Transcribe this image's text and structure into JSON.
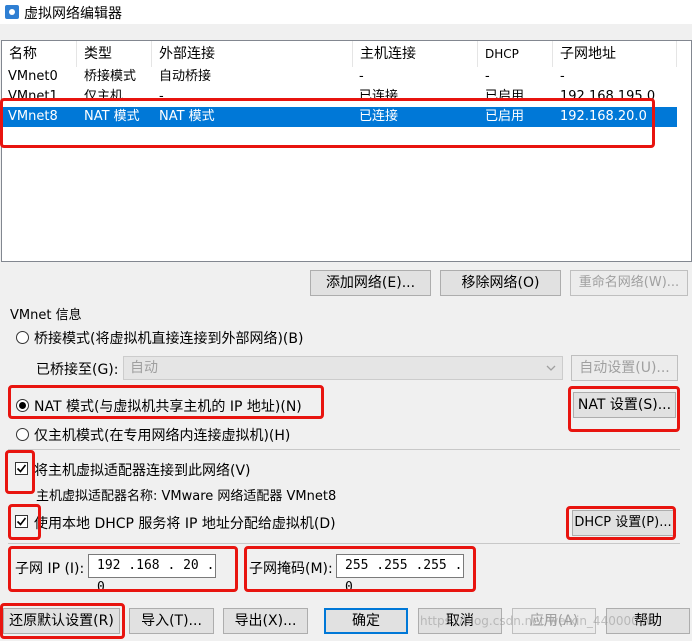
{
  "window": {
    "title": "虚拟网络编辑器"
  },
  "table": {
    "columns": [
      "名称",
      "类型",
      "外部连接",
      "主机连接",
      "DHCP",
      "子网地址"
    ],
    "rows": [
      [
        "VMnet0",
        "桥接模式",
        "自动桥接",
        "-",
        "-",
        "-"
      ],
      [
        "VMnet1",
        "仅主机...",
        "-",
        "已连接",
        "已启用",
        "192.168.195.0"
      ],
      [
        "VMnet8",
        "NAT 模式",
        "NAT 模式",
        "已连接",
        "已启用",
        "192.168.20.0"
      ]
    ]
  },
  "list_buttons": {
    "add": "添加网络(E)...",
    "remove": "移除网络(O)",
    "rename": "重命名网络(W)..."
  },
  "vmnet_info": {
    "group_label": "VMnet 信息",
    "bridge_radio": "桥接模式(将虚拟机直接连接到外部网络)(B)",
    "bridged_to_label": "已桥接至(G):",
    "bridged_to_value": "自动",
    "auto_settings": "自动设置(U)...",
    "nat_radio": "NAT 模式(与虚拟机共享主机的 IP 地址)(N)",
    "nat_settings": "NAT 设置(S)...",
    "hostonly_radio": "仅主机模式(在专用网络内连接虚拟机)(H)",
    "connect_adapter": "将主机虚拟适配器连接到此网络(V)",
    "adapter_name": "主机虚拟适配器名称: VMware 网络适配器 VMnet8",
    "use_dhcp": "使用本地 DHCP 服务将 IP 地址分配给虚拟机(D)",
    "dhcp_settings": "DHCP 设置(P)...",
    "subnet_ip_label": "子网 IP (I):",
    "subnet_ip_value": "192 .168 . 20 . 0",
    "subnet_mask_label": "子网掩码(M):",
    "subnet_mask_value": "255 .255 .255 . 0"
  },
  "footer_buttons": {
    "restore": "还原默认设置(R)",
    "import": "导入(T)...",
    "export": "导出(X)...",
    "ok": "确定",
    "cancel": "取消",
    "apply": "应用(A)",
    "help": "帮助"
  },
  "watermark": "https://blog.csdn.net/weixin_44000000"
}
